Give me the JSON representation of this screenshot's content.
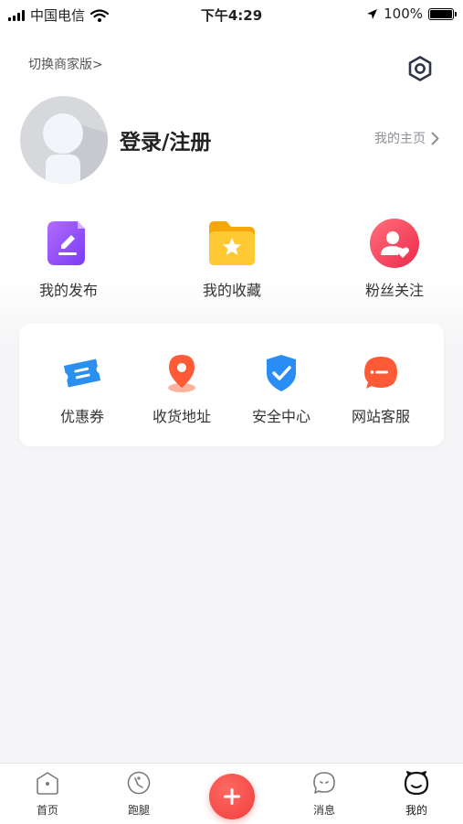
{
  "status_bar": {
    "carrier": "中国电信",
    "time": "下午4:29",
    "battery": "100%"
  },
  "header": {
    "switch_merchant": "切换商家版>",
    "settings_icon": "settings-hexagon-icon"
  },
  "profile": {
    "login_label": "登录/注册",
    "my_home_label": "我的主页"
  },
  "quick_actions": [
    {
      "label": "我的发布",
      "icon": "edit-document-icon",
      "color": "#8b4dff"
    },
    {
      "label": "我的收藏",
      "icon": "star-folder-icon",
      "color": "#ffc01e"
    },
    {
      "label": "粉丝关注",
      "icon": "user-heart-icon",
      "color": "#ff3d5c"
    }
  ],
  "services": [
    {
      "label": "优惠券",
      "icon": "coupon-icon",
      "color": "#2b8ff0"
    },
    {
      "label": "收货地址",
      "icon": "location-pin-icon",
      "color": "#ff5a36"
    },
    {
      "label": "安全中心",
      "icon": "shield-check-icon",
      "color": "#2a8cf5"
    },
    {
      "label": "网站客服",
      "icon": "chat-bubble-icon",
      "color": "#ff5a36"
    }
  ],
  "tab_bar": {
    "items": [
      {
        "label": "首页",
        "icon": "home-icon"
      },
      {
        "label": "跑腿",
        "icon": "errand-icon"
      },
      {
        "label": "消息",
        "icon": "message-icon"
      },
      {
        "label": "我的",
        "icon": "profile-face-icon",
        "active": true
      }
    ],
    "publish_icon": "plus-icon",
    "accent": "#ef3d3d"
  }
}
